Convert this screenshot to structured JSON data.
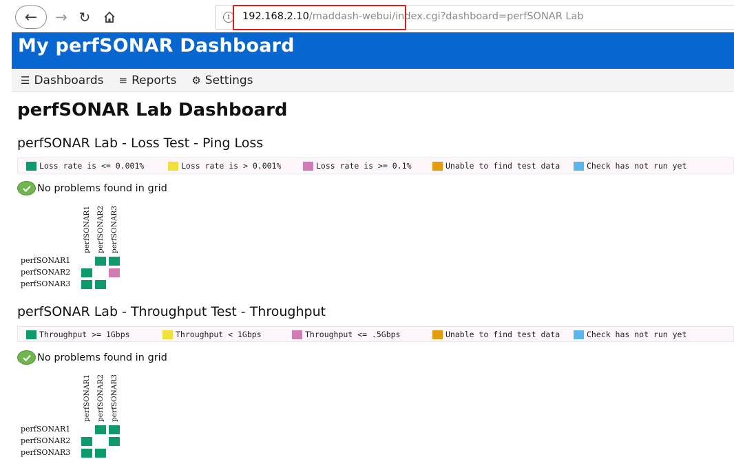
{
  "browser": {
    "back_icon": "arrow-left-icon",
    "forward_icon": "arrow-right-icon",
    "reload_icon": "reload-icon",
    "home_icon": "home-icon",
    "url_host": "192.168.2.10",
    "url_path": "/maddash-webui/index.cgi?dashboard=perfSONAR Lab",
    "highlight_color": "#e01b1b"
  },
  "header": {
    "title": "My perfSONAR Dashboard",
    "color": "#0766d0"
  },
  "menu": [
    {
      "label": "Dashboards",
      "icon": "hamburger-icon"
    },
    {
      "label": "Reports",
      "icon": "list-icon"
    },
    {
      "label": "Settings",
      "icon": "gear-icon"
    }
  ],
  "page_title": "perfSONAR Lab Dashboard",
  "colors": {
    "green": "#0f9a6b",
    "yellow": "#efe13a",
    "pink": "#d17bb3",
    "orange": "#e39b0f",
    "blue": "#59b6ea"
  },
  "sections": [
    {
      "title": "perfSONAR Lab - Loss Test - Ping Loss",
      "legend": [
        {
          "label": "Loss rate is <= 0.001%",
          "color": "#0f9a6b"
        },
        {
          "label": "Loss rate is > 0.001%",
          "color": "#efe13a"
        },
        {
          "label": "Loss rate is >= 0.1%",
          "color": "#d17bb3"
        },
        {
          "label": "Unable to find test data",
          "color": "#e39b0f"
        },
        {
          "label": "Check has not run yet",
          "color": "#59b6ea"
        }
      ],
      "status": "No problems found in grid",
      "columns": [
        "perfSONAR1",
        "perfSONAR2",
        "perfSONAR3"
      ],
      "rows": [
        "perfSONAR1",
        "perfSONAR2",
        "perfSONAR3"
      ],
      "cells": [
        [
          null,
          "green",
          "green"
        ],
        [
          "green",
          null,
          "pink"
        ],
        [
          "green",
          "green",
          null
        ]
      ]
    },
    {
      "title": "perfSONAR Lab - Throughput Test - Throughput",
      "legend": [
        {
          "label": "Throughput >= 1Gbps",
          "color": "#0f9a6b"
        },
        {
          "label": "Throughput < 1Gbps",
          "color": "#efe13a"
        },
        {
          "label": "Throughput <= .5Gbps",
          "color": "#d17bb3"
        },
        {
          "label": "Unable to find test data",
          "color": "#e39b0f"
        },
        {
          "label": "Check has not run yet",
          "color": "#59b6ea"
        }
      ],
      "status": "No problems found in grid",
      "columns": [
        "perfSONAR1",
        "perfSONAR2",
        "perfSONAR3"
      ],
      "rows": [
        "perfSONAR1",
        "perfSONAR2",
        "perfSONAR3"
      ],
      "cells": [
        [
          null,
          "green",
          "green"
        ],
        [
          "green",
          null,
          "green"
        ],
        [
          "green",
          "green",
          null
        ]
      ]
    }
  ]
}
